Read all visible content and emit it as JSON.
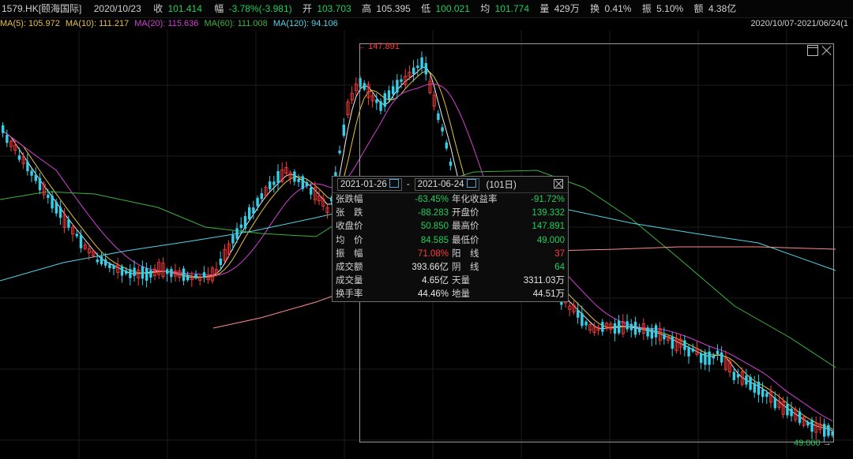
{
  "header": {
    "code": "1579.HK[颐海国际]",
    "date": "2020/10/23",
    "close_label": "收",
    "close": "101.414",
    "chg_label": "幅",
    "chg": "-3.78%(-3.981)",
    "open_label": "开",
    "open": "103.703",
    "high_label": "高",
    "high": "105.395",
    "low_label": "低",
    "low": "100.021",
    "avg_label": "均",
    "avg": "101.774",
    "vol_label": "量",
    "vol": "429万",
    "turn_label": "换",
    "turn": "0.41%",
    "amp_label": "振",
    "amp": "5.10%",
    "amt_label": "额",
    "amt": "4.38亿",
    "range": "2020/10/07-2021/06/24(1"
  },
  "ma": [
    {
      "label": "MA(5): 105.972",
      "color": "#e8c23a"
    },
    {
      "label": "MA(10): 111.217",
      "color": "#e8c23a"
    },
    {
      "label": "MA(20): 115.636",
      "color": "#d43fd4"
    },
    {
      "label": "MA(60): 111.008",
      "color": "#3ab43a"
    },
    {
      "label": "MA(120): 94.106",
      "color": "#4fd4e8"
    }
  ],
  "chart": {
    "high_label": "147.891",
    "low_label": "49.000",
    "colors": {
      "up": "#ff3a3a",
      "down": "#35d0e8",
      "ma5": "#f0f0f0",
      "ma10": "#e8c23a",
      "ma20": "#d43fd4",
      "ma60": "#3ab43a",
      "ma120": "#4fd4e8",
      "ma250": "#ff8c8c"
    }
  },
  "popup": {
    "start": "2021-01-26",
    "dash": "-",
    "end": "2021-06-24",
    "days": "(101日)",
    "rows": [
      {
        "k1": "张跌幅",
        "v1": "-63.45%",
        "c1": "grn",
        "k2": "年化收益率",
        "v2": "-91.72%",
        "c2": "grn"
      },
      {
        "k1": "张　跌",
        "v1": "-88.283",
        "c1": "grn",
        "k2": "开盘价",
        "v2": "139.332",
        "c2": "grn"
      },
      {
        "k1": "收盘价",
        "v1": "50.850",
        "c1": "grn",
        "k2": "最高价",
        "v2": "147.891",
        "c2": "grn"
      },
      {
        "k1": "均　价",
        "v1": "84.585",
        "c1": "grn",
        "k2": "最低价",
        "v2": "49.000",
        "c2": "grn"
      },
      {
        "k1": "振　幅",
        "v1": "71.08%",
        "c1": "red",
        "k2": "阳　线",
        "v2": "37",
        "c2": "red"
      },
      {
        "k1": "成交额",
        "v1": "393.66亿",
        "c1": "wht",
        "k2": "阴　线",
        "v2": "64",
        "c2": "grn"
      },
      {
        "k1": "成交量",
        "v1": "4.65亿",
        "c1": "wht",
        "k2": "天量",
        "v2": "3311.03万",
        "c2": "wht"
      },
      {
        "k1": "换手率",
        "v1": "44.46%",
        "c1": "wht",
        "k2": "地量",
        "v2": "44.51万",
        "c2": "wht"
      }
    ]
  }
}
